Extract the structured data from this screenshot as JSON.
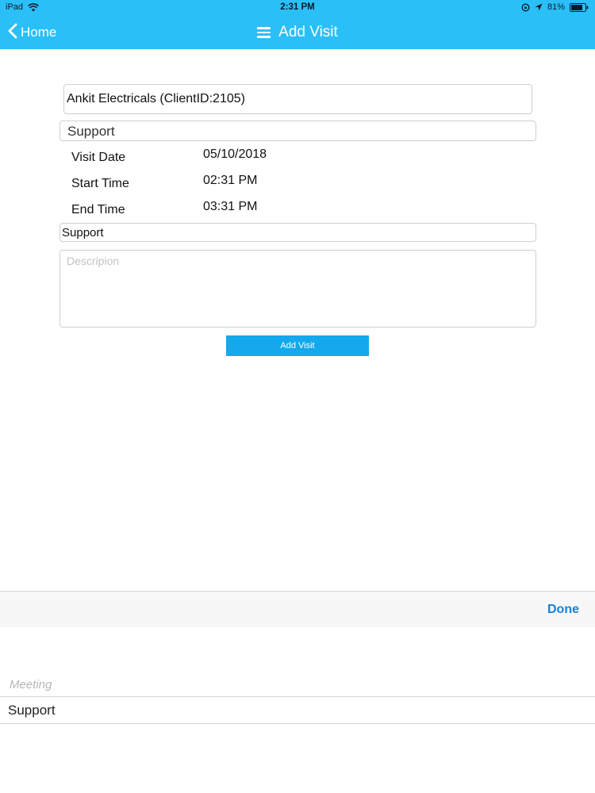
{
  "status_bar": {
    "device": "iPad",
    "time": "2:31 PM",
    "battery": "81%"
  },
  "nav": {
    "back_label": "Home",
    "title": "Add Visit"
  },
  "form": {
    "client": "Ankit Electricals  (ClientID:2105)",
    "visit_type": "Support",
    "rows": [
      {
        "label": "Visit Date",
        "value": "05/10/2018"
      },
      {
        "label": "Start Time",
        "value": "02:31 PM"
      },
      {
        "label": "End Time",
        "value": "03:31 PM"
      }
    ],
    "title_value": "Support",
    "description_placeholder": "Descripion",
    "submit_label": "Add Visit"
  },
  "picker": {
    "done_label": "Done",
    "options": [
      "Meeting",
      "Support"
    ],
    "selected": "Support"
  },
  "colors": {
    "nav_bar": "#2bbff7",
    "button": "#13a9ec",
    "done": "#1a7fd3"
  }
}
